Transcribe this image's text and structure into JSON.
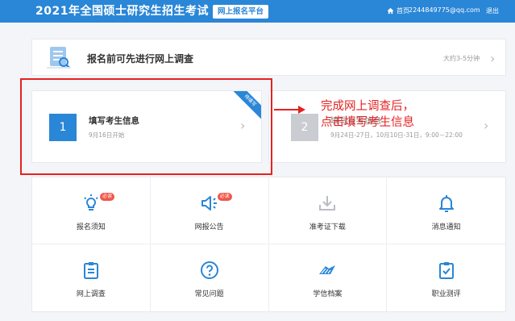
{
  "header": {
    "title": "2021年全国硕士研究生招生考试",
    "platform": "网上报名平台",
    "home": "首页",
    "email": "2244849775@qq.com",
    "logout": "退出"
  },
  "survey": {
    "title": "报名前可先进行网上调查",
    "time": "大约3-5分钟"
  },
  "steps": [
    {
      "number": "1",
      "title": "填写考生信息",
      "date": "9月16日开始",
      "ribbon": "待填写"
    },
    {
      "number": "2",
      "title": "填写报考信息",
      "date": "9月24日-27日，10月10日-31日，9:00－22:00"
    }
  ],
  "annotation": {
    "line1": "完成网上调查后，",
    "line2": "点击填写考生信息"
  },
  "tiles": [
    {
      "label": "报名须知",
      "badge": "必读",
      "icon": "bulb-icon"
    },
    {
      "label": "网报公告",
      "badge": "必读",
      "icon": "speaker-icon"
    },
    {
      "label": "准考证下载",
      "icon": "download-icon"
    },
    {
      "label": "消息通知",
      "icon": "bell-icon"
    },
    {
      "label": "网上调查",
      "icon": "clipboard-icon"
    },
    {
      "label": "常见问题",
      "icon": "question-icon"
    },
    {
      "label": "学信档案",
      "icon": "archive-icon"
    },
    {
      "label": "职业测评",
      "icon": "assessment-icon"
    }
  ],
  "colors": {
    "brand": "#2a86d6",
    "annotation": "#e52222",
    "badge": "#f0564a",
    "disabled": "#c9ccd1"
  }
}
